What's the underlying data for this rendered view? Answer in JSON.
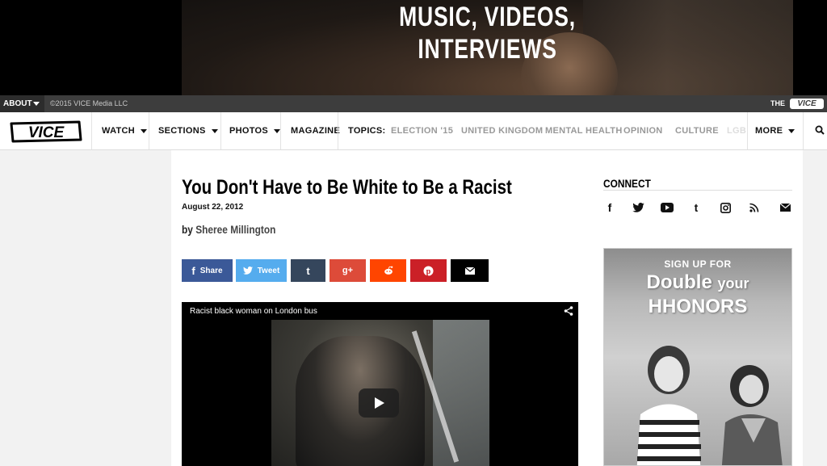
{
  "banner": {
    "line1": "MUSIC, VIDEOS,",
    "line2": "INTERVIEWS"
  },
  "utility_bar": {
    "about_label": "ABOUT",
    "copyright": "©2015 VICE Media LLC",
    "the_label": "THE",
    "vice_label": "VICE"
  },
  "nav": {
    "logo": "VICE",
    "items": [
      {
        "label": "WATCH"
      },
      {
        "label": "SECTIONS"
      },
      {
        "label": "PHOTOS"
      },
      {
        "label": "MAGAZINE"
      }
    ],
    "topics_label": "TOPICS:",
    "topics": [
      "ELECTION '15",
      "UNITED KINGDOM",
      "MENTAL HEALTH",
      "OPINION",
      "CULTURE",
      "LGBT"
    ],
    "more_label": "MORE"
  },
  "article": {
    "title": "You Don't Have to Be White to Be a Racist",
    "date": "August 22, 2012",
    "by": "by",
    "author": "Sheree Millington"
  },
  "share_buttons": {
    "facebook": "Share",
    "twitter": "Tweet"
  },
  "colors": {
    "facebook": "#3b5998",
    "twitter": "#55acee",
    "tumblr": "#35465c",
    "googleplus": "#dd4b39",
    "reddit": "#ff4500",
    "pinterest": "#cb2027",
    "email": "#000000"
  },
  "video": {
    "title": "Racist black woman on London bus"
  },
  "connect": {
    "title": "CONNECT",
    "icons": [
      "facebook-icon",
      "twitter-icon",
      "youtube-icon",
      "tumblr-icon",
      "instagram-icon",
      "rss-icon",
      "email-icon"
    ]
  },
  "ad": {
    "line1": "SIGN UP FOR",
    "line2a": "Double",
    "line2b": "your",
    "line3": "HHONORS"
  }
}
